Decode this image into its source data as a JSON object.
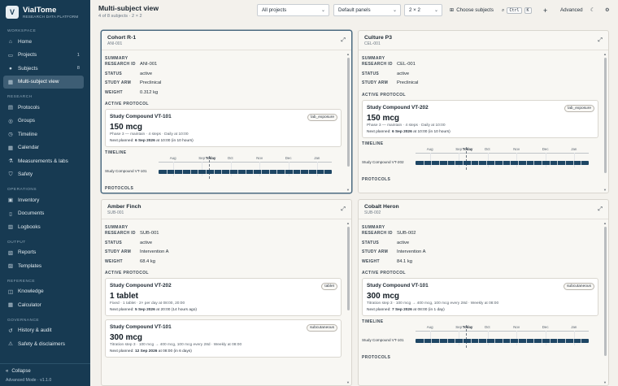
{
  "app": {
    "name": "VialTome",
    "tagline": "RESEARCH DATA PLATFORM",
    "logo_letter": "V"
  },
  "sidebar": {
    "sections": [
      {
        "label": "WORKSPACE",
        "items": [
          {
            "label": "Home",
            "icon": "home-icon",
            "glyph": "⌂"
          },
          {
            "label": "Projects",
            "icon": "folder-icon",
            "glyph": "▭",
            "count": "1"
          },
          {
            "label": "Subjects",
            "icon": "user-icon",
            "glyph": "●",
            "count": "8"
          },
          {
            "label": "Multi-subject view",
            "icon": "grid-icon",
            "glyph": "▦",
            "active": true
          }
        ]
      },
      {
        "label": "RESEARCH",
        "items": [
          {
            "label": "Protocols",
            "icon": "clipboard-icon",
            "glyph": "▤"
          },
          {
            "label": "Groups",
            "icon": "users-icon",
            "glyph": "◎"
          },
          {
            "label": "Timeline",
            "icon": "clock-icon",
            "glyph": "◷"
          },
          {
            "label": "Calendar",
            "icon": "calendar-icon",
            "glyph": "▦"
          },
          {
            "label": "Measurements & labs",
            "icon": "flask-icon",
            "glyph": "⚗"
          },
          {
            "label": "Safety",
            "icon": "shield-icon",
            "glyph": "⛉"
          }
        ]
      },
      {
        "label": "OPERATIONS",
        "items": [
          {
            "label": "Inventory",
            "icon": "box-icon",
            "glyph": "▣"
          },
          {
            "label": "Documents",
            "icon": "document-icon",
            "glyph": "▯"
          },
          {
            "label": "Logbooks",
            "icon": "book-icon",
            "glyph": "▥"
          }
        ]
      },
      {
        "label": "OUTPUT",
        "items": [
          {
            "label": "Reports",
            "icon": "chart-icon",
            "glyph": "▧"
          },
          {
            "label": "Templates",
            "icon": "template-icon",
            "glyph": "▨"
          }
        ]
      },
      {
        "label": "REFERENCE",
        "items": [
          {
            "label": "Knowledge",
            "icon": "book-open-icon",
            "glyph": "◫"
          },
          {
            "label": "Calculator",
            "icon": "calculator-icon",
            "glyph": "▦"
          }
        ]
      },
      {
        "label": "GOVERNANCE",
        "items": [
          {
            "label": "History & audit",
            "icon": "history-icon",
            "glyph": "↺"
          },
          {
            "label": "Safety & disclaimers",
            "icon": "alert-icon",
            "glyph": "⚠"
          }
        ]
      }
    ],
    "collapse_label": "Collapse",
    "version": "Advanced Mode · v1.1.0"
  },
  "header": {
    "title": "Multi-subject view",
    "subtitle": "4 of 8 subjects · 2 × 2",
    "project_select": "All projects",
    "panels_select": "Default panels",
    "grid_select": "2 × 2",
    "choose_subjects": "Choose subjects",
    "kbd_ctrl": "Ctrl",
    "kbd_k": "K",
    "advanced": "Advanced"
  },
  "labels": {
    "summary": "SUMMARY",
    "research_id": "RESEARCH ID",
    "status": "STATUS",
    "study_arm": "STUDY ARM",
    "weight": "WEIGHT",
    "active_protocol": "ACTIVE PROTOCOL",
    "timeline": "TIMELINE",
    "protocols": "PROTOCOLS",
    "today": "Today"
  },
  "timeline_months": [
    "Aug",
    "Sep",
    "Oct",
    "Nov",
    "Dec",
    "Jan"
  ],
  "subjects": [
    {
      "name": "Cohort R-1",
      "id": "ANI-001",
      "research_id": "ANI-001",
      "status": "active",
      "arm": "Preclinical",
      "weight": "0.312 kg",
      "protocols": [
        {
          "name": "Study Compound VT-101",
          "route": "lab_exposure",
          "dose": "150 mcg",
          "detail": "Phase 3 — maintain · 4 steps · Daily at 10:00",
          "next_prefix": "Next planned:",
          "next_date": "6 Sep 2026",
          "next_rest": "at 10:00 (in 10 hours)"
        }
      ],
      "timeline_label": "Study Compound VT-101",
      "scroll": {
        "thumb_top": 0.0,
        "thumb_size": 0.85
      }
    },
    {
      "name": "Culture P3",
      "id": "CEL-001",
      "research_id": "CEL-001",
      "status": "active",
      "arm": "Preclinical",
      "protocols": [
        {
          "name": "Study Compound VT-202",
          "route": "lab_exposure",
          "dose": "150 mcg",
          "detail": "Phase 3 — maintain · 4 steps · Daily at 10:00",
          "next_prefix": "Next planned:",
          "next_date": "6 Sep 2026",
          "next_rest": "at 10:00 (in 10 hours)"
        }
      ],
      "timeline_label": "Study Compound VT-202",
      "scroll": {
        "thumb_top": 0.0,
        "thumb_size": 0.9
      }
    },
    {
      "name": "Amber Finch",
      "id": "SUB-001",
      "research_id": "SUB-001",
      "status": "active",
      "arm": "Intervention A",
      "weight": "68.4 kg",
      "protocols": [
        {
          "name": "Study Compound VT-202",
          "route": "tablet",
          "dose": "1 tablet",
          "detail": "Fixed · 1 tablet · 2× per day at 08:00, 20:00",
          "next_prefix": "Next planned:",
          "next_date": "5 Sep 2026",
          "next_rest": "at 20:00 (14 hours ago)"
        },
        {
          "name": "Study Compound VT-101",
          "route": "subcutaneous",
          "dose": "300 mcg",
          "detail": "Titration step 3 · 100 mcg → 400 mcg, 100 mcg every 28d · Weekly at 08:00",
          "next_prefix": "Next planned:",
          "next_date": "12 Sep 2026",
          "next_rest": "at 08:00 (in 6 days)"
        }
      ],
      "scroll": {
        "thumb_top": 0.0,
        "thumb_size": 0.55
      }
    },
    {
      "name": "Cobalt Heron",
      "id": "SUB-002",
      "research_id": "SUB-002",
      "status": "active",
      "arm": "Intervention A",
      "weight": "84.1 kg",
      "protocols": [
        {
          "name": "Study Compound VT-101",
          "route": "subcutaneous",
          "dose": "300 mcg",
          "detail": "Titration step 3 · 100 mcg → 400 mcg, 100 mcg every 28d · Weekly at 08:00",
          "next_prefix": "Next planned:",
          "next_date": "7 Sep 2026",
          "next_rest": "at 08:00 (in 1 day)"
        }
      ],
      "timeline_label": "Study Compound VT-101",
      "scroll": {
        "thumb_top": 0.0,
        "thumb_size": 0.85
      }
    }
  ],
  "colors": {
    "sidebar": "#173a52",
    "accent": "#1e4664",
    "active_nav": "#3d5d74"
  }
}
